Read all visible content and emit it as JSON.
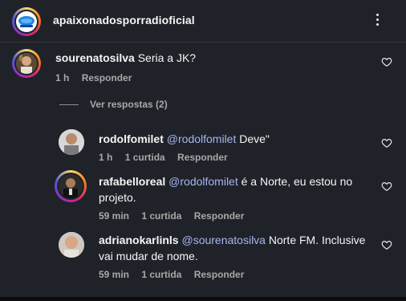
{
  "post": {
    "username": "apaixonadosporradioficial"
  },
  "colors": {
    "mention": "#a7b6f0",
    "meta": "#a8a8a8",
    "background": "#1f2228"
  },
  "comments": [
    {
      "username": "sourenatosilva",
      "text": "Seria a JK?",
      "time": "1 h",
      "reply_label": "Responder"
    }
  ],
  "view_replies_label": "Ver respostas (2)",
  "replies": [
    {
      "username": "rodolfomilet",
      "mention": "@rodolfomilet",
      "text": " Deve\"",
      "time": "1 h",
      "likes": "1 curtida",
      "reply_label": "Responder"
    },
    {
      "username": "rafabelloreal",
      "mention": "@rodolfomilet",
      "text": " é a Norte, eu estou no projeto.",
      "time": "59 min",
      "likes": "1 curtida",
      "reply_label": "Responder"
    },
    {
      "username": "adrianokarlinls",
      "mention": "@sourenatosilva",
      "text": " Norte FM. Inclusive vai mudar de nome.",
      "time": "59 min",
      "likes": "1 curtida",
      "reply_label": "Responder"
    }
  ],
  "icons": {
    "heart": "heart-icon",
    "more": "more-options-icon"
  }
}
